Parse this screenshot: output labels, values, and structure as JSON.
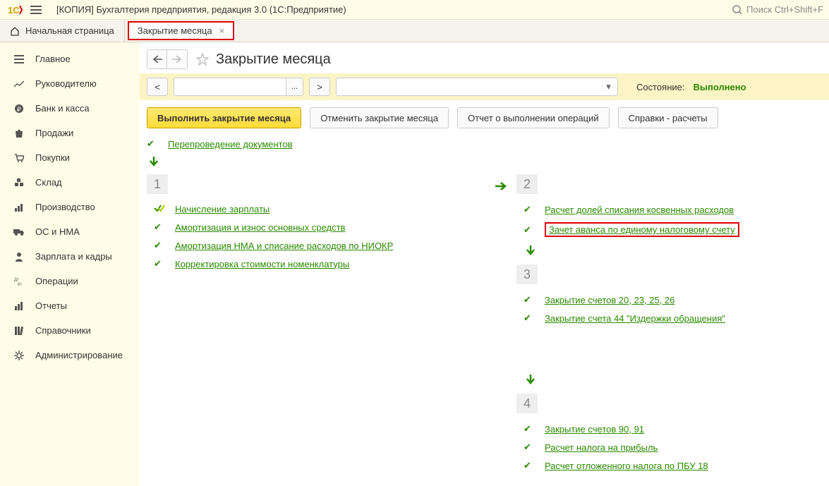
{
  "header": {
    "title": "[КОПИЯ] Бухгалтерия предприятия, редакция 3.0  (1С:Предприятие)",
    "search_placeholder": "Поиск Ctrl+Shift+F"
  },
  "tabs": {
    "home": "Начальная страница",
    "active": "Закрытие месяца"
  },
  "sidebar": {
    "items": [
      {
        "label": "Главное"
      },
      {
        "label": "Руководителю"
      },
      {
        "label": "Банк и касса"
      },
      {
        "label": "Продажи"
      },
      {
        "label": "Покупки"
      },
      {
        "label": "Склад"
      },
      {
        "label": "Производство"
      },
      {
        "label": "ОС и НМА"
      },
      {
        "label": "Зарплата и кадры"
      },
      {
        "label": "Операции"
      },
      {
        "label": "Отчеты"
      },
      {
        "label": "Справочники"
      },
      {
        "label": "Администрирование"
      }
    ]
  },
  "page": {
    "title": "Закрытие месяца",
    "toolbar": {
      "prev": "<",
      "next": ">",
      "ellipsis": "...",
      "state_label": "Состояние:",
      "state_value": "Выполнено"
    },
    "buttons": {
      "primary": "Выполнить закрытие месяца",
      "cancel": "Отменить закрытие месяца",
      "report": "Отчет о выполнении операций",
      "calc": "Справки - расчеты"
    },
    "preop": {
      "reprocess": "Перепроведение документов"
    },
    "stage1": {
      "num": "1",
      "items": [
        "Начисление зарплаты",
        "Амортизация и износ основных средств",
        "Амортизация НМА и списание расходов по НИОКР",
        "Корректировка стоимости номенклатуры"
      ]
    },
    "stage2": {
      "num": "2",
      "items": [
        "Расчет долей списания косвенных расходов",
        "Зачет аванса по единому налоговому счету"
      ]
    },
    "stage3": {
      "num": "3",
      "items": [
        "Закрытие счетов 20, 23, 25, 26",
        "Закрытие счета 44 \"Издержки обращения\""
      ]
    },
    "stage4": {
      "num": "4",
      "items": [
        "Закрытие счетов 90, 91",
        "Расчет налога на прибыль",
        "Расчет отложенного налога по ПБУ 18"
      ]
    }
  }
}
